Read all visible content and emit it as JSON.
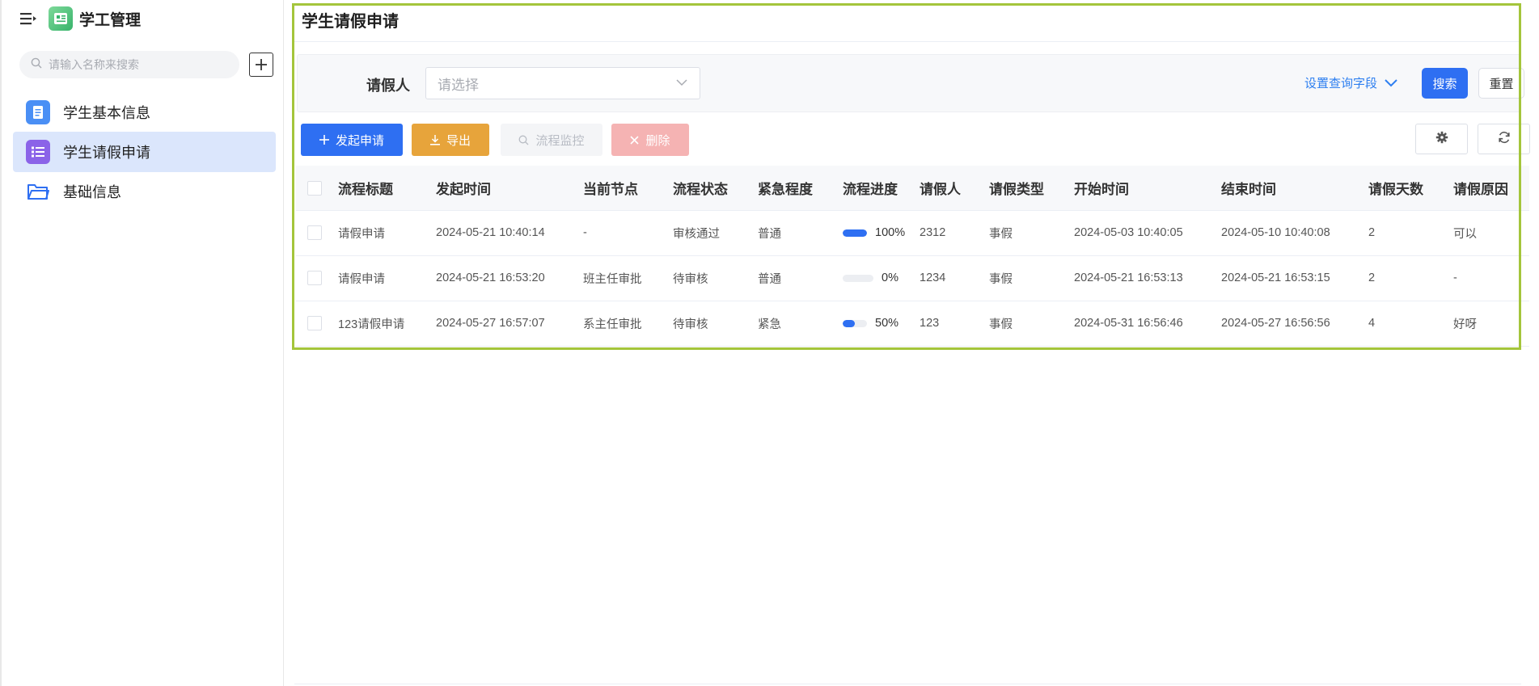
{
  "sidebar": {
    "app_title": "学工管理",
    "search_placeholder": "请输入名称来搜索",
    "items": [
      {
        "label": "学生基本信息",
        "icon": "document-icon",
        "color": "#4a8ff5",
        "active": false
      },
      {
        "label": "学生请假申请",
        "icon": "list-icon",
        "color": "#8b63e8",
        "active": true
      },
      {
        "label": "基础信息",
        "icon": "folder-icon",
        "color": "#2e6ff2",
        "active": false
      }
    ]
  },
  "page": {
    "title": "学生请假申请"
  },
  "filter": {
    "label": "请假人",
    "select_placeholder": "请选择",
    "set_fields_label": "设置查询字段",
    "search_label": "搜索",
    "reset_label": "重置"
  },
  "toolbar": {
    "new_label": "发起申请",
    "export_label": "导出",
    "monitor_label": "流程监控",
    "delete_label": "删除"
  },
  "table": {
    "columns": [
      "流程标题",
      "发起时间",
      "当前节点",
      "流程状态",
      "紧急程度",
      "流程进度",
      "请假人",
      "请假类型",
      "开始时间",
      "结束时间",
      "请假天数",
      "请假原因"
    ],
    "rows": [
      {
        "title": "请假申请",
        "created": "2024-05-21 10:40:14",
        "node": "-",
        "status": "审核通过",
        "urgency": "普通",
        "progress": 100,
        "progress_label": "100%",
        "applicant": "2312",
        "type": "事假",
        "start": "2024-05-03 10:40:05",
        "end": "2024-05-10 10:40:08",
        "days": "2",
        "reason": "可以"
      },
      {
        "title": "请假申请",
        "created": "2024-05-21 16:53:20",
        "node": "班主任审批",
        "status": "待审核",
        "urgency": "普通",
        "progress": 0,
        "progress_label": "0%",
        "applicant": "1234",
        "type": "事假",
        "start": "2024-05-21 16:53:13",
        "end": "2024-05-21 16:53:15",
        "days": "2",
        "reason": "-"
      },
      {
        "title": "123请假申请",
        "created": "2024-05-27 16:57:07",
        "node": "系主任审批",
        "status": "待审核",
        "urgency": "紧急",
        "progress": 50,
        "progress_label": "50%",
        "applicant": "123",
        "type": "事假",
        "start": "2024-05-31 16:56:46",
        "end": "2024-05-27 16:56:56",
        "days": "4",
        "reason": "好呀"
      }
    ]
  },
  "colors": {
    "primary": "#2e6ff2",
    "export": "#e7a43b",
    "delete": "#f5b3b3",
    "highlight": "#a4c53b",
    "active_nav": "#dbe6fc"
  }
}
